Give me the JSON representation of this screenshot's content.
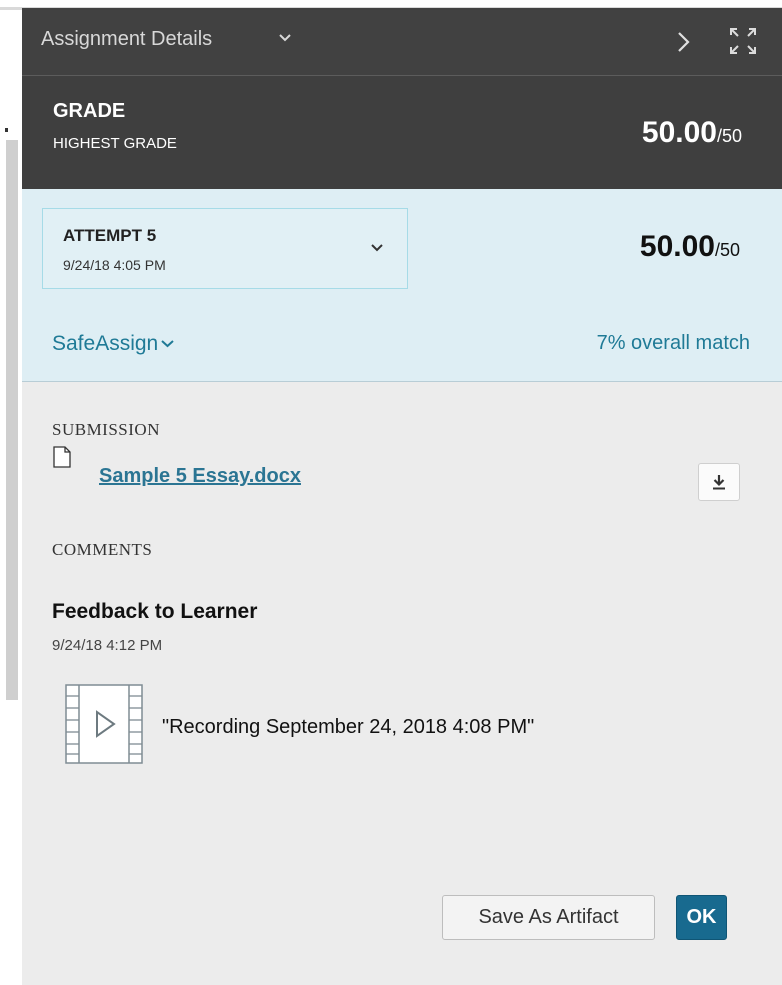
{
  "header": {
    "title": "Assignment Details"
  },
  "grade": {
    "title": "GRADE",
    "subtitle": "HIGHEST GRADE",
    "score": "50.00",
    "possible": "/50"
  },
  "attempt": {
    "label": "ATTEMPT 5",
    "date": "9/24/18 4:05 PM",
    "score": "50.00",
    "possible": "/50"
  },
  "safeassign": {
    "label": "SafeAssign",
    "match": "7% overall match"
  },
  "submission": {
    "section_label": "SUBMISSION",
    "file_name": "Sample 5 Essay.docx"
  },
  "comments": {
    "section_label": "COMMENTS",
    "feedback_title": "Feedback to Learner",
    "feedback_date": "9/24/18 4:12 PM",
    "recording_title": "\"Recording September 24, 2018 4:08 PM\""
  },
  "actions": {
    "save_artifact_label": "Save As Artifact",
    "ok_label": "OK"
  },
  "icons": {
    "header_dropdown": "chevron-down-icon",
    "next": "chevron-right-icon",
    "expand": "expand-icon",
    "attempt_dropdown": "chevron-down-icon",
    "safeassign_dropdown": "chevron-down-icon",
    "file": "document-icon",
    "download": "download-icon",
    "recording": "video-play-icon"
  },
  "colors": {
    "header_bg": "#414141",
    "attempt_bg": "#deeef4",
    "link": "#1f7a96",
    "ok_button": "#186a8f",
    "panel_bg": "#ececec"
  }
}
